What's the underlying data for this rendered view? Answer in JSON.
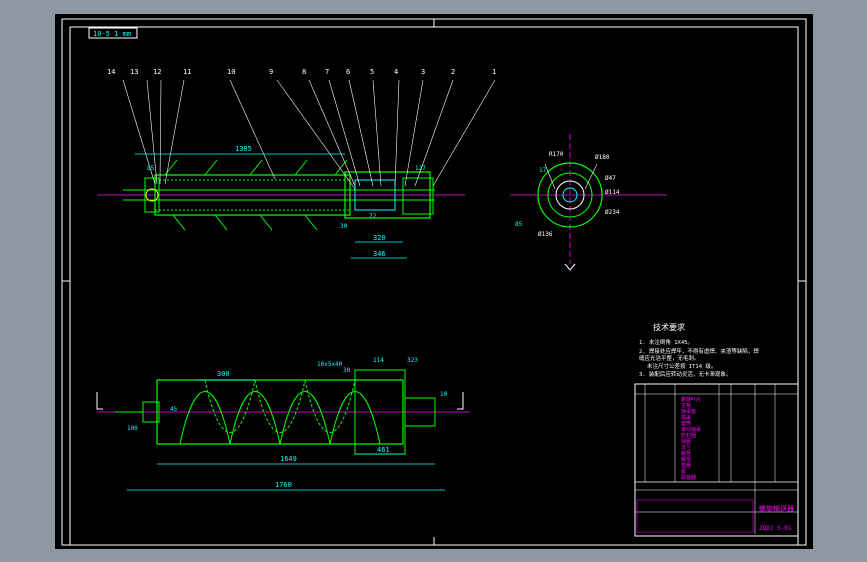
{
  "sheet": {
    "corner_tag": "10-5 1 mm",
    "part_numbers": [
      "14",
      "13",
      "12",
      "11",
      "10",
      "9",
      "8",
      "7",
      "6",
      "5",
      "4",
      "3",
      "2",
      "1"
    ],
    "dims_top": {
      "d1305": "1305",
      "d320": "320",
      "d346": "346",
      "d72": "72",
      "d85": "85",
      "d30": "30",
      "d127": "127"
    },
    "dims_section": {
      "phi180": "Ø180",
      "phi47": "Ø47",
      "phi114": "Ø114",
      "phi234": "Ø234",
      "phi136": "Ø136",
      "r170": "R170",
      "d85": "85",
      "d17": "17"
    },
    "dims_bottom": {
      "d300": "300",
      "key": "10x5x40",
      "d114": "114",
      "d323": "323",
      "d30": "30",
      "d100": "100",
      "d461": "461",
      "d1649": "1649",
      "d1760": "1760",
      "d45": "45",
      "d10": "10"
    }
  },
  "tech_notes": {
    "title": "技术要求",
    "lines": [
      "1. 未注倒角 1X45。",
      "2. 焊接处应焊牢，不得有虚焊、夹渣等缺陷，焊",
      "缝应光洁平整，无毛刺。",
      "未注尺寸公差按 IT14 级。",
      "3. 装配后应转动灵活，无卡滞现象。"
    ]
  },
  "title_block": {
    "name": "螺旋输送器",
    "drawing_no": "ZQDJ 5-01",
    "bom_rows": [
      "螺旋叶片",
      "主轴",
      "轴承座",
      "端盖",
      "套筒",
      "滚动轴承",
      "密封圈",
      "挡圈",
      "法兰",
      "螺栓",
      "螺母",
      "垫圈",
      "键",
      "联轴器"
    ]
  },
  "colors": {
    "background": "#000000",
    "outline": "#00ff00",
    "dimension": "#00ffff",
    "centerline": "#ff00ff",
    "leader": "#ffffff",
    "hidden": "#ff4444"
  }
}
